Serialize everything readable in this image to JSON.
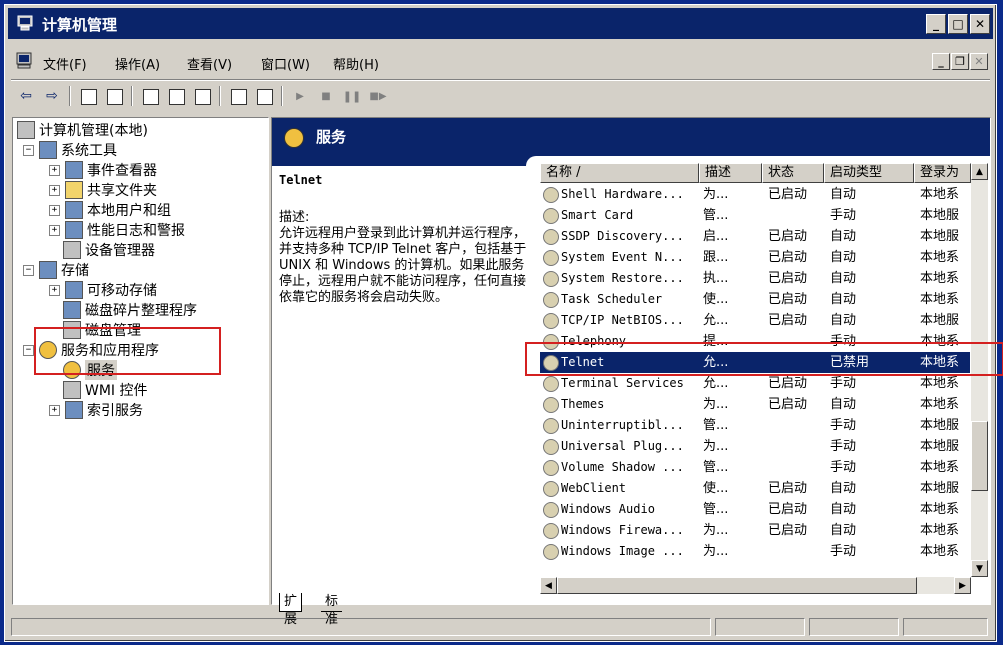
{
  "window": {
    "title": "计算机管理"
  },
  "menu": {
    "items": [
      "文件(F)",
      "操作(A)",
      "查看(V)",
      "窗口(W)",
      "帮助(H)"
    ]
  },
  "tree": {
    "root": "计算机管理(本地)",
    "system_tools": "系统工具",
    "event_viewer": "事件查看器",
    "shared_folders": "共享文件夹",
    "local_users": "本地用户和组",
    "perf_logs": "性能日志和警报",
    "device_manager": "设备管理器",
    "storage": "存储",
    "removable": "可移动存储",
    "defrag": "磁盘碎片整理程序",
    "disk_mgmt": "磁盘管理",
    "services_apps": "服务和应用程序",
    "services": "服务",
    "wmi": "WMI 控件",
    "indexing": "索引服务"
  },
  "panel": {
    "header": "服务",
    "service_name": "Telnet",
    "desc_label": "描述:",
    "desc_text": "允许远程用户登录到此计算机并运行程序，并支持多种 TCP/IP Telnet 客户，包括基于 UNIX 和 Windows 的计算机。如果此服务停止，远程用户就不能访问程序，任何直接依靠它的服务将会启动失败。"
  },
  "list": {
    "columns": [
      "名称 /",
      "描述",
      "状态",
      "启动类型",
      "登录为"
    ],
    "rows": [
      [
        "Shell Hardware...",
        "为...",
        "已启动",
        "自动",
        "本地系"
      ],
      [
        "Smart Card",
        "管...",
        "",
        "手动",
        "本地服"
      ],
      [
        "SSDP Discovery...",
        "启...",
        "已启动",
        "自动",
        "本地服"
      ],
      [
        "System Event N...",
        "跟...",
        "已启动",
        "自动",
        "本地系"
      ],
      [
        "System Restore...",
        "执...",
        "已启动",
        "自动",
        "本地系"
      ],
      [
        "Task Scheduler",
        "使...",
        "已启动",
        "自动",
        "本地系"
      ],
      [
        "TCP/IP NetBIOS...",
        "允...",
        "已启动",
        "自动",
        "本地服"
      ],
      [
        "Telephony",
        "提...",
        "",
        "手动",
        "本地系"
      ],
      [
        "Telnet",
        "允...",
        "",
        "已禁用",
        "本地系"
      ],
      [
        "Terminal Services",
        "允...",
        "已启动",
        "手动",
        "本地系"
      ],
      [
        "Themes",
        "为...",
        "已启动",
        "自动",
        "本地系"
      ],
      [
        "Uninterruptibl...",
        "管...",
        "",
        "手动",
        "本地服"
      ],
      [
        "Universal Plug...",
        "为...",
        "",
        "手动",
        "本地服"
      ],
      [
        "Volume Shadow ...",
        "管...",
        "",
        "手动",
        "本地系"
      ],
      [
        "WebClient",
        "使...",
        "已启动",
        "自动",
        "本地服"
      ],
      [
        "Windows Audio",
        "管...",
        "已启动",
        "自动",
        "本地系"
      ],
      [
        "Windows Firewa...",
        "为...",
        "已启动",
        "自动",
        "本地系"
      ],
      [
        "Windows Image ...",
        "为...",
        "",
        "手动",
        "本地系"
      ]
    ],
    "selected_index": 8
  },
  "tabs": [
    "扩展",
    "标准"
  ],
  "colors": {
    "titlebar": "#0a246a",
    "desktop": "#0b2a8a",
    "highlight_box": "#d42020"
  }
}
